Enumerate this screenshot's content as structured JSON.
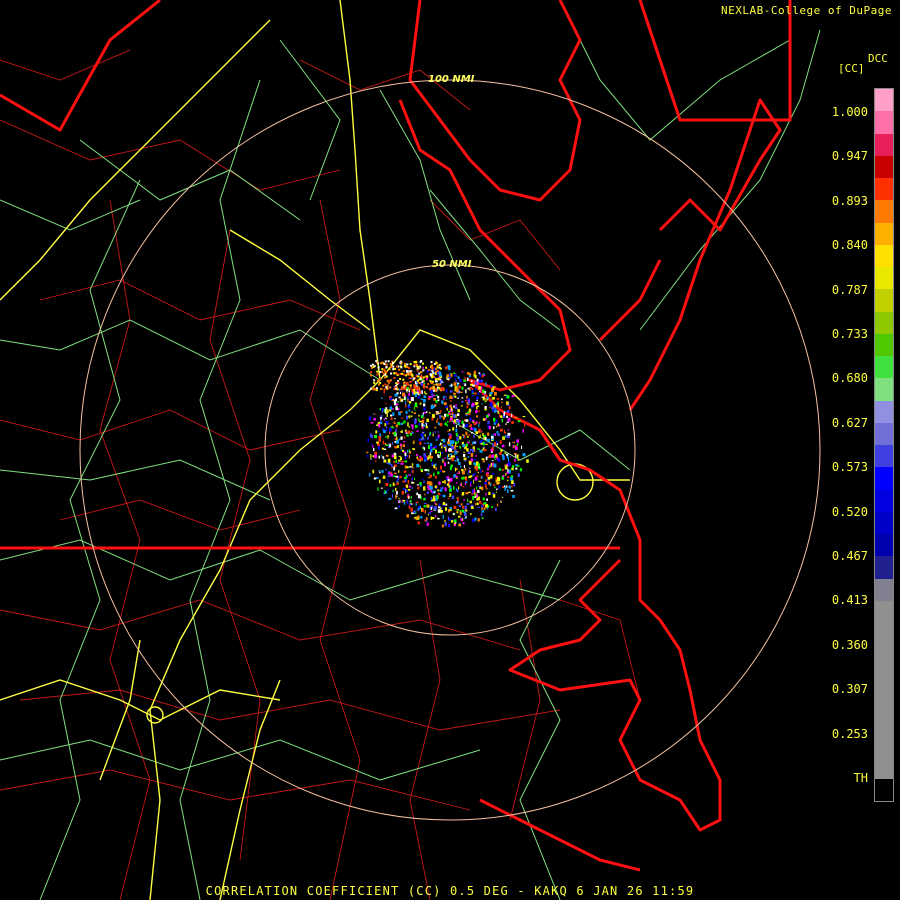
{
  "credit": "NEXLAB-College of DuPage",
  "legend": {
    "unit_top": "DCC",
    "unit_sub": "[CC]",
    "ticks": [
      "1.000",
      "0.947",
      "0.893",
      "0.840",
      "0.787",
      "0.733",
      "0.680",
      "0.627",
      "0.573",
      "0.520",
      "0.467",
      "0.413",
      "0.360",
      "0.307",
      "0.253",
      "TH"
    ],
    "colors": [
      "#ff9ec8",
      "#ff6fa8",
      "#e8205a",
      "#c80000",
      "#ff3000",
      "#ff7a00",
      "#ffb000",
      "#ffe000",
      "#e8e800",
      "#c0d000",
      "#90c800",
      "#50c800",
      "#40e040",
      "#80e080",
      "#9090e0",
      "#7070d8",
      "#4040e0",
      "#0000ff",
      "#0000e0",
      "#0000c8",
      "#0000b0",
      "#202090",
      "#808090",
      "#909090",
      "#909090",
      "#909090",
      "#909090",
      "#909090",
      "#909090",
      "#909090",
      "#909090",
      "#000000"
    ]
  },
  "range_rings": [
    {
      "label": "100 NMI",
      "range_nmi": 100
    },
    {
      "label": "50 NMI",
      "range_nmi": 50
    }
  ],
  "footer": "CORRELATION COEFFICIENT (CC) 0.5 DEG - KAKQ 6 JAN 26 11:59",
  "colors": {
    "state": "#ff1010",
    "county": "#c81818",
    "highway": "#ffff40",
    "road": "#80e080",
    "ring": "#f4c0a0"
  }
}
